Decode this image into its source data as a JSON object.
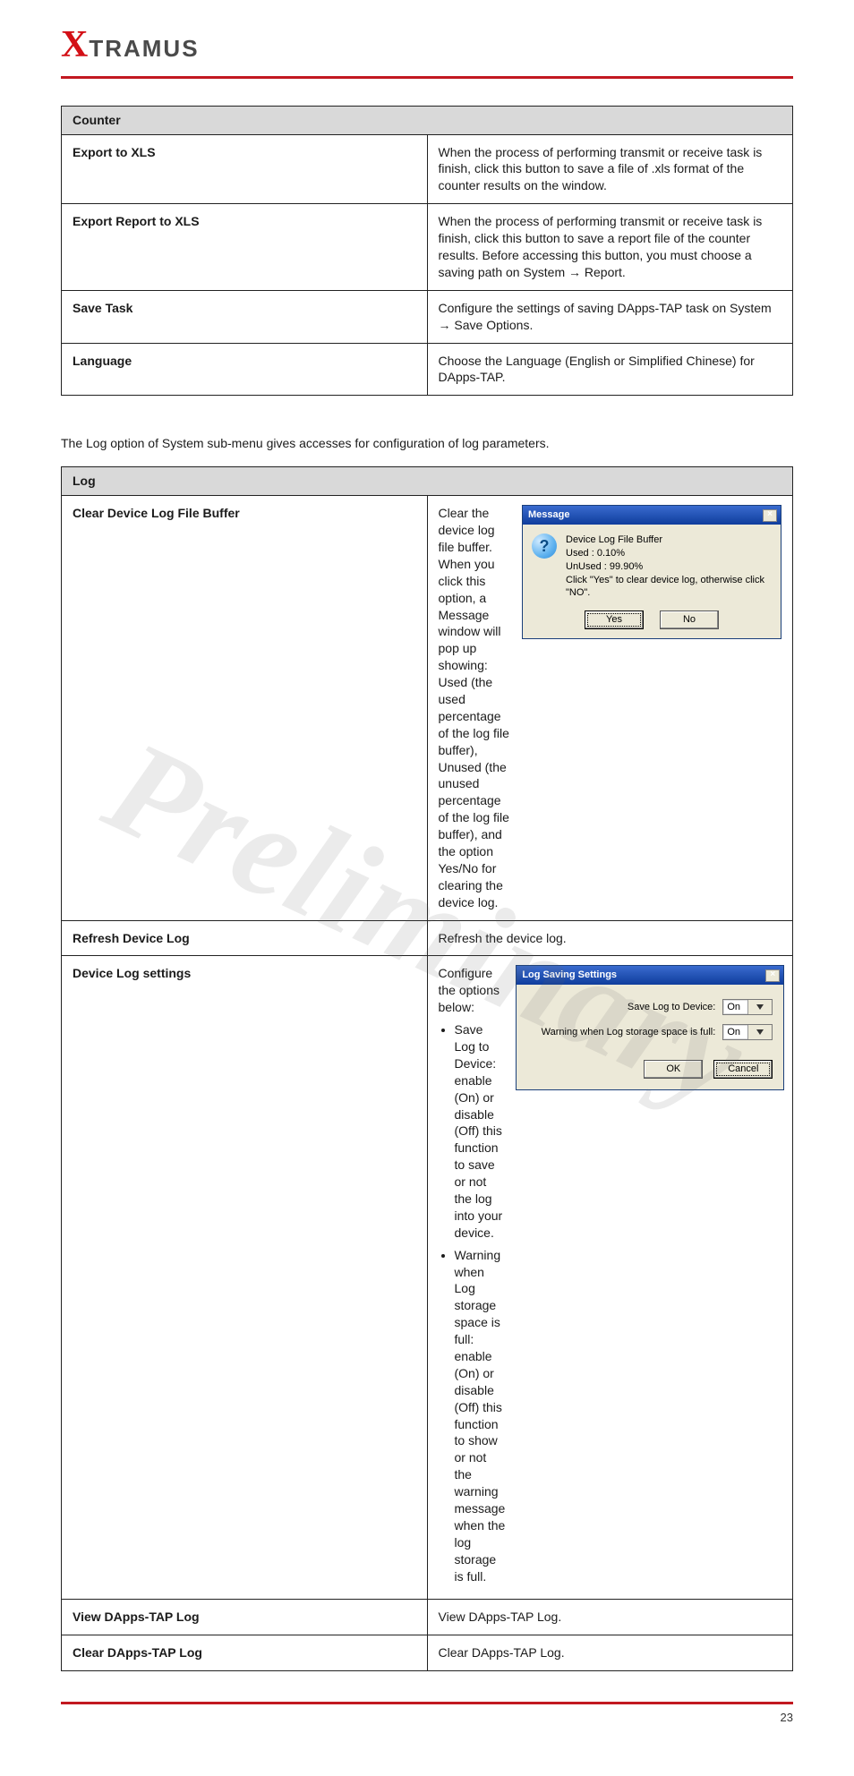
{
  "brand": {
    "x": "X",
    "rest": "TRAMUS"
  },
  "watermark": "Preliminary",
  "table_counter": {
    "header": "Counter",
    "rows": [
      {
        "label": "Export to XLS",
        "text": "When the process of performing transmit or receive task is finish, click this button to save a file of .xls format of the counter results on the window."
      },
      {
        "label": "Export Report to XLS",
        "text": "When the process of performing transmit or receive task is finish, click this button to save a report file of the counter results. Before accessing this button, you must choose a saving path on System → Report."
      },
      {
        "label": "Save Task",
        "text": "Configure the settings of saving DApps-TAP task on System → Save Options."
      },
      {
        "label": "Language",
        "text": "Choose the Language (English or Simplified Chinese) for DApps-TAP."
      }
    ]
  },
  "log_intro": "The Log option of System sub-menu gives accesses for configuration of log parameters.",
  "table_log": {
    "header": "Log",
    "rows": [
      {
        "label": "Clear Device Log File Buffer",
        "text": "Clear the device log file buffer. When you click this option, a Message window will pop up showing: Used (the used percentage of the log file buffer), Unused (the unused percentage of the log file buffer), and the option Yes/No for clearing the device log.",
        "dialog": "msg"
      },
      {
        "label": "Refresh Device Log",
        "text": "Refresh the device log."
      },
      {
        "label": "Device Log settings",
        "text_intro": "Configure the options below:",
        "bullets": [
          "Save Log to Device: enable (On) or disable (Off) this function to save or not the log into your device.",
          "Warning when Log storage space is full: enable (On) or disable (Off) this function to show or not the warning message when the log storage is full."
        ],
        "dialog": "settings"
      },
      {
        "label": "View DApps-TAP Log",
        "text": "View DApps-TAP Log."
      },
      {
        "label": "Clear DApps-TAP Log",
        "text": "Clear DApps-TAP Log."
      }
    ]
  },
  "msg_dialog": {
    "title": "Message",
    "lines": [
      "Device Log File Buffer",
      "Used : 0.10%",
      "UnUsed : 99.90%",
      "Click \"Yes\" to clear device log, otherwise click \"NO\"."
    ],
    "yes": "Yes",
    "no": "No"
  },
  "settings_dialog": {
    "title": "Log Saving Settings",
    "row1_label": "Save Log to Device:",
    "row1_value": "On",
    "row2_label": "Warning when Log storage space is full:",
    "row2_value": "On",
    "ok": "OK",
    "cancel": "Cancel"
  },
  "footer": {
    "page": "23"
  }
}
